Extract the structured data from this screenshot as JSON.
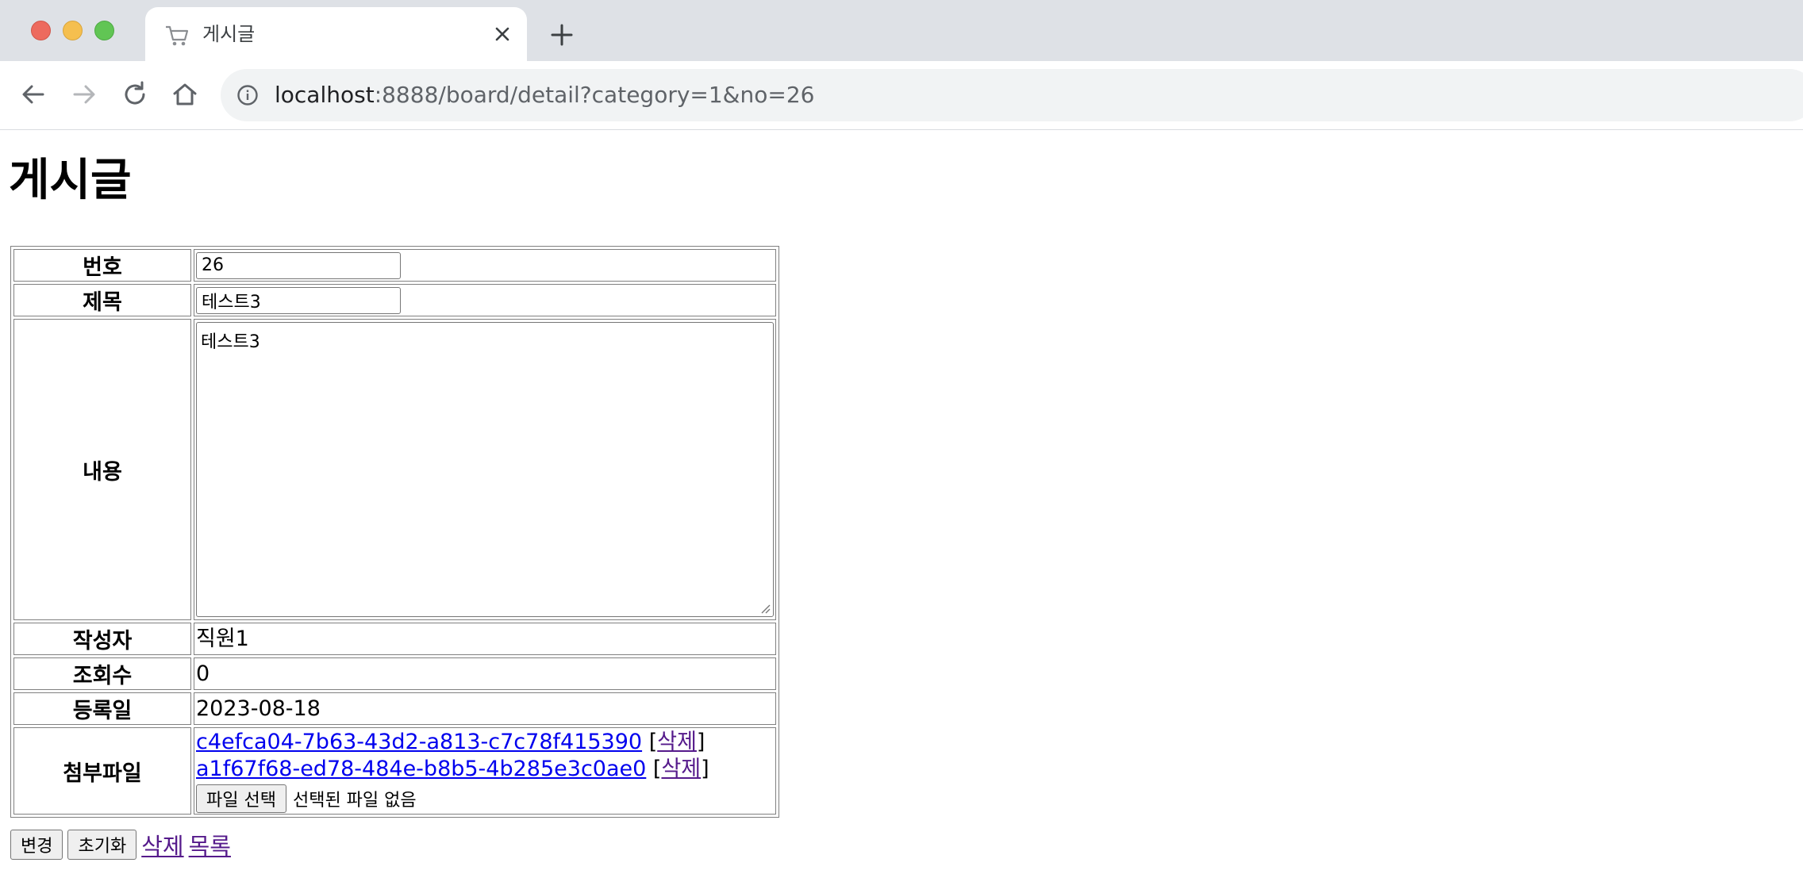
{
  "browser": {
    "tab_title": "게시글",
    "url_host": "localhost",
    "url_rest": ":8888/board/detail?category=1&no=26"
  },
  "page": {
    "title": "게시글",
    "fields": {
      "no_label": "번호",
      "no_value": "26",
      "subject_label": "제목",
      "subject_value": "테스트3",
      "content_label": "내용",
      "content_value": "테스트3",
      "writer_label": "작성자",
      "writer_value": "직원1",
      "views_label": "조회수",
      "views_value": "0",
      "date_label": "등록일",
      "date_value": "2023-08-18",
      "files_label": "첨부파일"
    },
    "attachments": [
      {
        "name": "c4efca04-7b63-43d2-a813-c7c78f415390",
        "delete_label": "삭제"
      },
      {
        "name": "a1f67f68-ed78-484e-b8b5-4b285e3c0ae0",
        "delete_label": "삭제"
      }
    ],
    "file_input": {
      "button_label": "파일 선택",
      "status": "선택된 파일 없음"
    },
    "actions": {
      "update_label": "변경",
      "reset_label": "초기화",
      "delete_label": "삭제",
      "list_label": "목록"
    }
  },
  "colors": {
    "link": "#0000ee",
    "visited_link": "#551a8b",
    "tabbar_bg": "#dee1e6",
    "omnibox_bg": "#f1f3f4"
  },
  "icons": [
    "shopping-cart-icon",
    "close-icon",
    "plus-icon",
    "arrow-left-icon",
    "arrow-right-icon",
    "reload-icon",
    "home-icon",
    "info-icon"
  ]
}
